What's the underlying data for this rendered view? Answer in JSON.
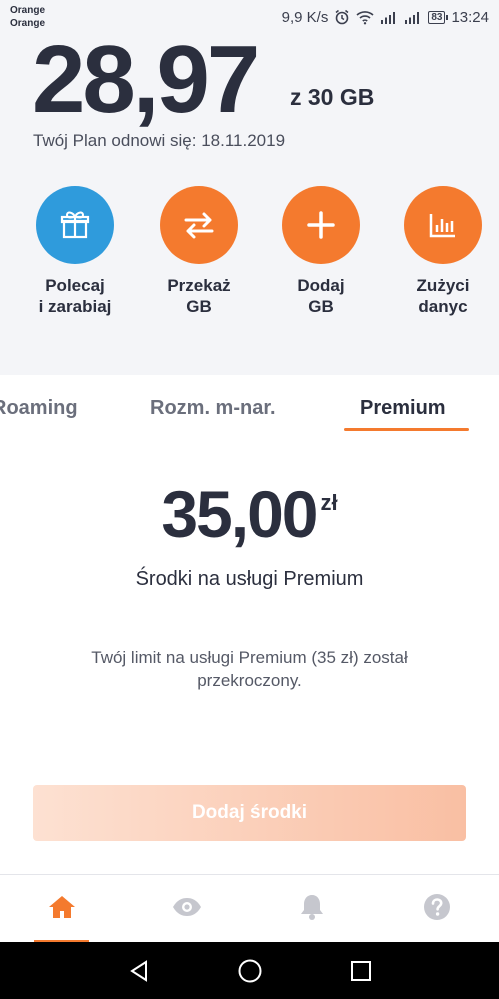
{
  "status_bar": {
    "carrier_1": "Orange",
    "carrier_2": "Orange",
    "speed": "9,9 K/s",
    "battery": "83",
    "time": "13:24",
    "icons": [
      "alarm-icon",
      "wifi-icon",
      "signal-icon",
      "signal-icon",
      "battery-icon"
    ]
  },
  "usage": {
    "amount": "28,97",
    "of_total": "z 30 GB",
    "renew_text": "Twój Plan odnowi się: 18.11.2019"
  },
  "actions": [
    {
      "line1": "Polecaj",
      "line2": "i zarabiaj",
      "icon": "gift-icon",
      "color": "#2f9bdc"
    },
    {
      "line1": "Przekaż",
      "line2": "GB",
      "icon": "transfer-arrows-icon",
      "color": "#f47a2e"
    },
    {
      "line1": "Dodaj",
      "line2": "GB",
      "icon": "plus-icon",
      "color": "#f47a2e"
    },
    {
      "line1": "Zużyci",
      "line2": "danyc",
      "icon": "bar-chart-icon",
      "color": "#f47a2e"
    }
  ],
  "tabs": {
    "items": [
      "Roaming",
      "Rozm. m-nar.",
      "Premium"
    ],
    "active": "Premium"
  },
  "premium": {
    "value": "35,00",
    "currency": "zł",
    "caption": "Środki na usługi Premium",
    "note": "Twój limit na usługi Premium (35 zł) został przekroczony.",
    "button_label": "Dodaj środki"
  },
  "bottom_nav": {
    "items": [
      "home-icon",
      "eye-icon",
      "bell-icon",
      "help-icon"
    ],
    "active": "home-icon"
  },
  "system_nav": [
    "back-icon",
    "home-circle-icon",
    "recents-icon"
  ],
  "colors": {
    "accent_orange": "#f47a2e",
    "accent_blue": "#2f9bdc",
    "text_dark": "#2b2f3e"
  }
}
